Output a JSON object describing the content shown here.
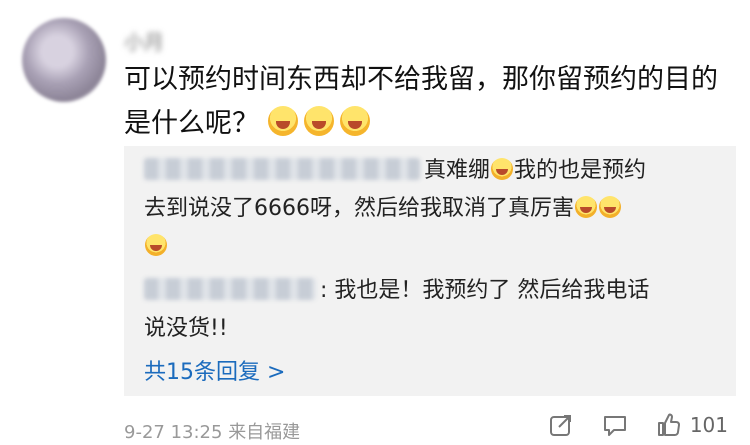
{
  "comment": {
    "username": "小月",
    "text_line1": "可以预约时间东西却不给我留，那你留预约的目的",
    "text_line2": "是什么呢？",
    "emoji_count": 3
  },
  "replies": [
    {
      "text_a": "真难绷",
      "text_b": "我的也是预约",
      "text_c": "去到说没了6666呀，然后给我取消了真厉害"
    },
    {
      "text_a": ": 我也是！我预约了 然后给我电话",
      "text_b": "说没货!!"
    }
  ],
  "more_replies_label": "共15条回复 >",
  "meta": {
    "timestamp": "9-27 13:25",
    "source": "来自福建"
  },
  "actions": {
    "like_count": "101"
  },
  "colors": {
    "link": "#1b6bbd",
    "meta": "#999999",
    "reply_bg": "#f2f2f2"
  }
}
